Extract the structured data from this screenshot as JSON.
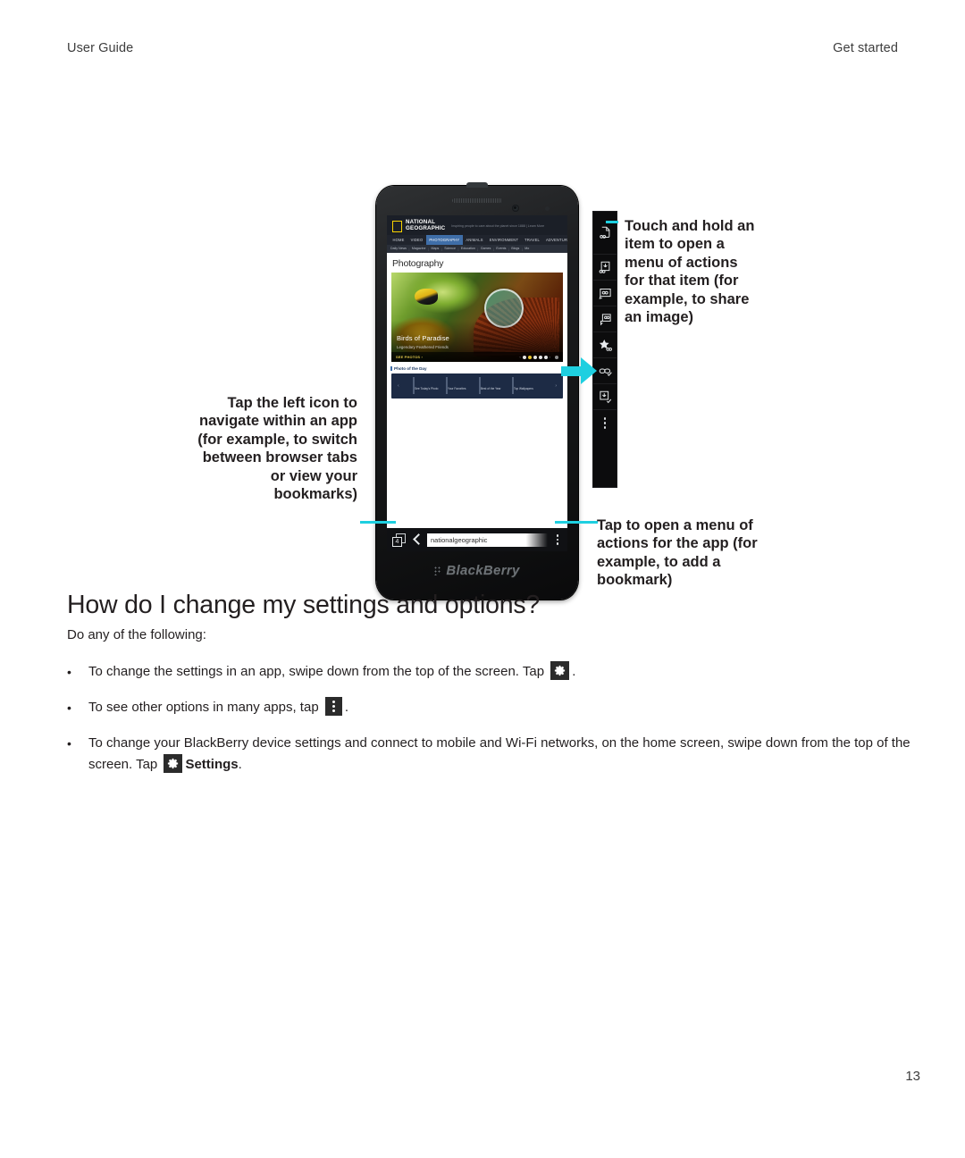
{
  "header": {
    "left": "User Guide",
    "right": "Get started"
  },
  "figure": {
    "callout_left": "Tap the left icon to navigate within an app (for example, to switch between browser tabs or view your bookmarks)",
    "callout_top_right": "Touch and hold an item to open a menu of actions for that item (for example, to share an image)",
    "callout_bottom_right": "Tap to open a menu of actions for the app (for example, to add a bookmark)",
    "accent_color": "#1ecfe0",
    "phone": {
      "brand": "BlackBerry",
      "speaker_icon": "speaker-grille-icon",
      "front_camera_icon": "front-camera-icon",
      "sensor_icon": "proximity-sensor-icon"
    },
    "screen": {
      "site": {
        "logo_line1": "NATIONAL",
        "logo_line2": "GEOGRAPHIC",
        "tagline": "Inspiring people to care about the planet since 1888  |  Learn More",
        "nav": [
          "HOME",
          "VIDEO",
          "PHOTOGRAPHY",
          "ANIMALS",
          "ENVIRONMENT",
          "TRAVEL",
          "ADVENTURE"
        ],
        "nav_active": "PHOTOGRAPHY",
        "subnav": [
          "Daily News",
          "Magazine",
          "Maps",
          "Science",
          "Education",
          "Games",
          "Events",
          "Blogs",
          "Mo"
        ],
        "page_title": "Photography",
        "hero": {
          "title": "Birds of Paradise",
          "subtitle": "Legendary Feathered Friends",
          "cta": "SEE PHOTOS ›",
          "carousel_dots": 5,
          "carousel_active_index": 1
        },
        "section_label": "Photo of the Day",
        "thumbnails": [
          {
            "caption": "See Today's Photo"
          },
          {
            "caption": "Your Favorites"
          },
          {
            "caption": "Best of the Year"
          },
          {
            "caption": "Top Wallpapers"
          }
        ]
      },
      "browser_bar": {
        "tabs_icon": "browser-tabs-icon",
        "tab_count": "4",
        "back_icon": "back-chevron-icon",
        "url_value": "nationalgeographic",
        "menu_icon": "overflow-menu-icon"
      }
    },
    "context_menu": {
      "items": [
        {
          "icon": "save-page-icon"
        },
        {
          "icon": "save-image-icon"
        },
        {
          "icon": "open-link-icon"
        },
        {
          "icon": "open-link-new-tab-icon"
        },
        {
          "icon": "add-bookmark-star-icon"
        },
        {
          "icon": "copy-link-icon"
        },
        {
          "icon": "download-icon"
        },
        {
          "icon": "more-actions-icon"
        }
      ]
    }
  },
  "content": {
    "heading": "How do I change my settings and options?",
    "intro": "Do any of the following:",
    "bullets": [
      {
        "before": "To change the settings in an app, swipe down from the top of the screen. Tap",
        "icon": "gear-icon",
        "after": "."
      },
      {
        "before": "To see other options in many apps, tap",
        "icon": "overflow-menu-icon",
        "after": "."
      },
      {
        "before": "To change your BlackBerry device settings and connect to mobile and Wi-Fi networks, on the home screen, swipe down from the top of the screen. Tap",
        "icon": "gear-icon",
        "bold": "Settings",
        "after": "."
      }
    ]
  },
  "page_number": "13"
}
